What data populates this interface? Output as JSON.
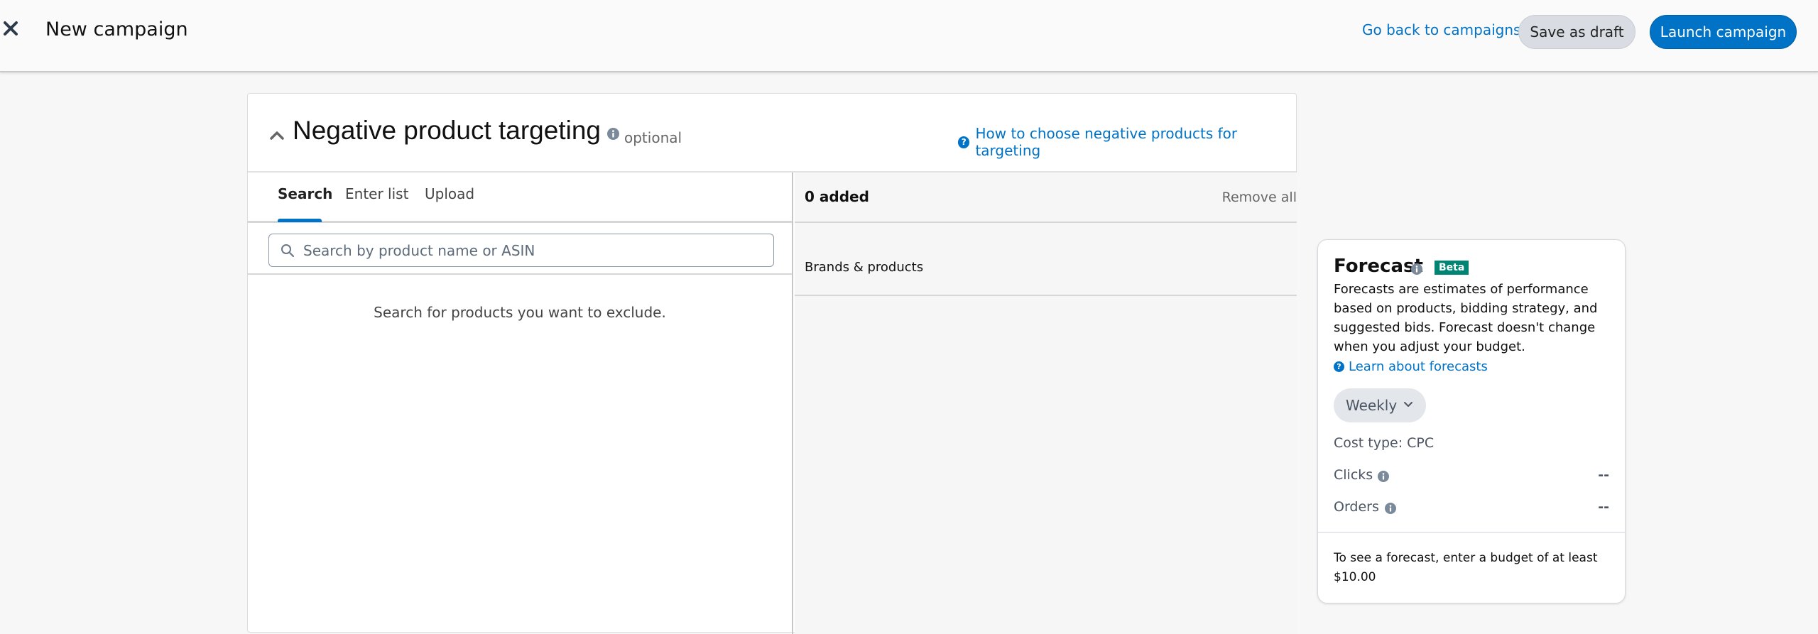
{
  "topbar": {
    "title": "New campaign",
    "close_icon": "close-icon",
    "back_link": "Go back to campaigns",
    "save_draft_label": "Save as draft",
    "launch_label": "Launch campaign"
  },
  "section": {
    "title": "Negative product targeting",
    "optional_label": "optional",
    "help_link": "How to choose negative products for targeting",
    "tabs": [
      {
        "label": "Search",
        "active": true
      },
      {
        "label": "Enter list",
        "active": false
      },
      {
        "label": "Upload",
        "active": false
      }
    ],
    "search": {
      "placeholder": "Search by product name or ASIN",
      "value": ""
    },
    "empty_message": "Search for products you want to exclude.",
    "added": {
      "count_label": "0 added",
      "remove_all_label": "Remove all",
      "column_header": "Brands & products"
    }
  },
  "forecast": {
    "title": "Forecast",
    "badge": "Beta",
    "description": "Forecasts are estimates of performance based on products, bidding strategy, and suggested bids. Forecast doesn't change when you adjust your budget.",
    "learn_link": "Learn about forecasts",
    "period": "Weekly",
    "cost_type": "Cost type: CPC",
    "metrics": [
      {
        "label": "Clicks",
        "value": "--"
      },
      {
        "label": "Orders",
        "value": "--"
      }
    ],
    "note": "To see a forecast, enter a budget of at least $10.00"
  },
  "colors": {
    "accent": "#0073c7",
    "beta_badge": "#008575",
    "draft_button": "#d9dde3"
  }
}
